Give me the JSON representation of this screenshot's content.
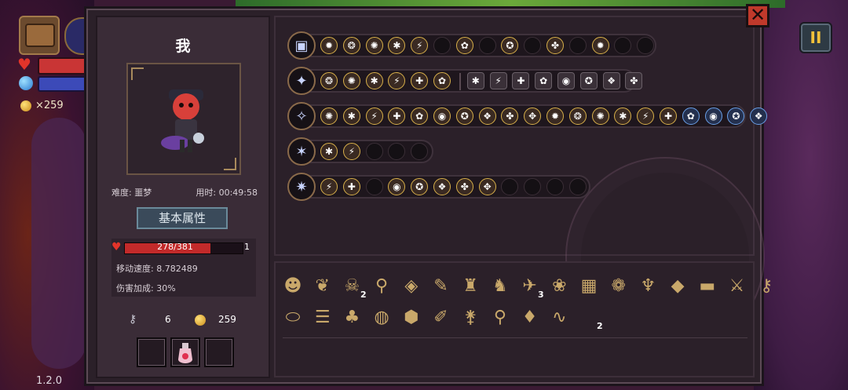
{
  "hud": {
    "coins_label": "×259",
    "version": "1.2.0",
    "pause_label": "II",
    "close_label": "✕"
  },
  "character": {
    "name": "我",
    "difficulty": "难度: 噩梦",
    "play_time": "用时: 00:49:58",
    "attributes_button": "基本属性",
    "hp_text": "278/381",
    "hp_current": 278,
    "hp_max": 381,
    "armor": "1",
    "move_speed": "移动速度: 8.782489",
    "damage_bonus": "伤害加成: 30%",
    "keys": "6",
    "gold": "259"
  },
  "bag_counts": {
    "imp": "2",
    "fish": "3",
    "hook": "2"
  },
  "colors": {
    "hp_red": "#c22a2a",
    "frame_bg": "#2b2029",
    "accent_gold": "#d8b04a"
  }
}
